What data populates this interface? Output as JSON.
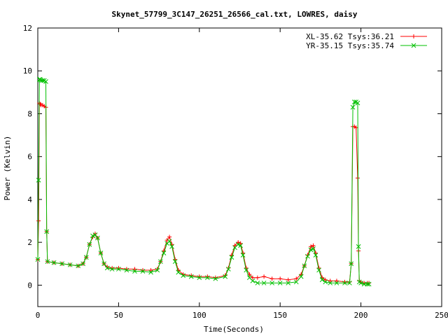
{
  "chart_data": {
    "type": "line",
    "title": "Skynet_57799_3C147_26251_26566_cal.txt, LOWRES, daisy",
    "xlabel": "Time(Seconds)",
    "ylabel": "Power (Kelvin)",
    "xlim": [
      0,
      250
    ],
    "ylim": [
      -1,
      12
    ],
    "xticks": [
      "0",
      "50",
      "100",
      "150",
      "200",
      "250"
    ],
    "yticks": [
      "0",
      "2",
      "4",
      "6",
      "8",
      "10",
      "12"
    ],
    "legend_position": "top-right",
    "grid": false,
    "series": [
      {
        "name": "XL-35.62 Tsys:36.21",
        "color": "#ff0000",
        "marker": "plus",
        "x": [
          0,
          0.5,
          1,
          1.5,
          2,
          3,
          4,
          5,
          5.5,
          6,
          10,
          15,
          20,
          25,
          28,
          30,
          32,
          34,
          35.5,
          37,
          39,
          41,
          43,
          46,
          50,
          55,
          60,
          65,
          70,
          74,
          76,
          78,
          80,
          81.5,
          83,
          85,
          87,
          90,
          95,
          100,
          105,
          110,
          116,
          118,
          120,
          122,
          124,
          125.5,
          127,
          129,
          131,
          133,
          136,
          140,
          145,
          150,
          155,
          160,
          163,
          165,
          167,
          169,
          170.5,
          172,
          174,
          176,
          178,
          181,
          185,
          190,
          193,
          194,
          195,
          196,
          197,
          198,
          198.5,
          199,
          200,
          202,
          204,
          205
        ],
        "y": [
          1.2,
          3.0,
          8.5,
          8.45,
          8.4,
          8.4,
          8.35,
          8.3,
          2.5,
          1.1,
          1.05,
          1.0,
          0.95,
          0.9,
          1.0,
          1.3,
          1.9,
          2.25,
          2.4,
          2.2,
          1.5,
          1.0,
          0.85,
          0.8,
          0.8,
          0.75,
          0.75,
          0.7,
          0.7,
          0.75,
          1.1,
          1.6,
          2.1,
          2.25,
          1.9,
          1.2,
          0.7,
          0.5,
          0.45,
          0.4,
          0.4,
          0.35,
          0.45,
          0.8,
          1.4,
          1.85,
          2.0,
          1.95,
          1.5,
          0.8,
          0.5,
          0.35,
          0.35,
          0.4,
          0.3,
          0.3,
          0.25,
          0.3,
          0.5,
          0.9,
          1.4,
          1.8,
          1.85,
          1.5,
          0.8,
          0.35,
          0.25,
          0.2,
          0.2,
          0.15,
          0.15,
          1.0,
          7.4,
          7.4,
          7.35,
          5.0,
          1.6,
          0.2,
          0.15,
          0.1,
          0.1,
          0.1
        ]
      },
      {
        "name": "YR-35.15 Tsys:35.74",
        "color": "#00c000",
        "marker": "cross",
        "x": [
          0,
          0.5,
          1,
          1.5,
          2,
          3,
          4,
          5,
          5.5,
          6,
          10,
          15,
          20,
          25,
          28,
          30,
          32,
          34,
          35.5,
          37,
          39,
          41,
          43,
          46,
          50,
          55,
          60,
          65,
          70,
          74,
          76,
          78,
          80,
          81.5,
          83,
          85,
          87,
          90,
          95,
          100,
          105,
          110,
          116,
          118,
          120,
          122,
          124,
          125.5,
          127,
          129,
          131,
          133,
          136,
          140,
          145,
          150,
          155,
          160,
          163,
          165,
          167,
          169,
          170.5,
          172,
          174,
          176,
          178,
          181,
          185,
          190,
          193,
          194,
          195,
          196,
          197,
          198,
          198.5,
          199,
          200,
          202,
          204,
          205
        ],
        "y": [
          1.2,
          4.9,
          9.6,
          9.6,
          9.55,
          9.55,
          9.55,
          9.5,
          2.5,
          1.1,
          1.05,
          1.0,
          0.95,
          0.9,
          1.0,
          1.3,
          1.9,
          2.3,
          2.35,
          2.2,
          1.5,
          1.0,
          0.8,
          0.75,
          0.75,
          0.7,
          0.65,
          0.65,
          0.6,
          0.7,
          1.1,
          1.5,
          1.95,
          2.05,
          1.8,
          1.1,
          0.6,
          0.45,
          0.4,
          0.35,
          0.35,
          0.3,
          0.4,
          0.75,
          1.3,
          1.75,
          1.9,
          1.85,
          1.4,
          0.7,
          0.35,
          0.2,
          0.1,
          0.1,
          0.1,
          0.1,
          0.1,
          0.15,
          0.4,
          0.9,
          1.35,
          1.65,
          1.7,
          1.4,
          0.7,
          0.25,
          0.15,
          0.1,
          0.1,
          0.1,
          0.1,
          1.0,
          8.3,
          8.55,
          8.55,
          8.5,
          1.8,
          0.15,
          0.1,
          0.05,
          0.05,
          0.05
        ]
      }
    ]
  }
}
